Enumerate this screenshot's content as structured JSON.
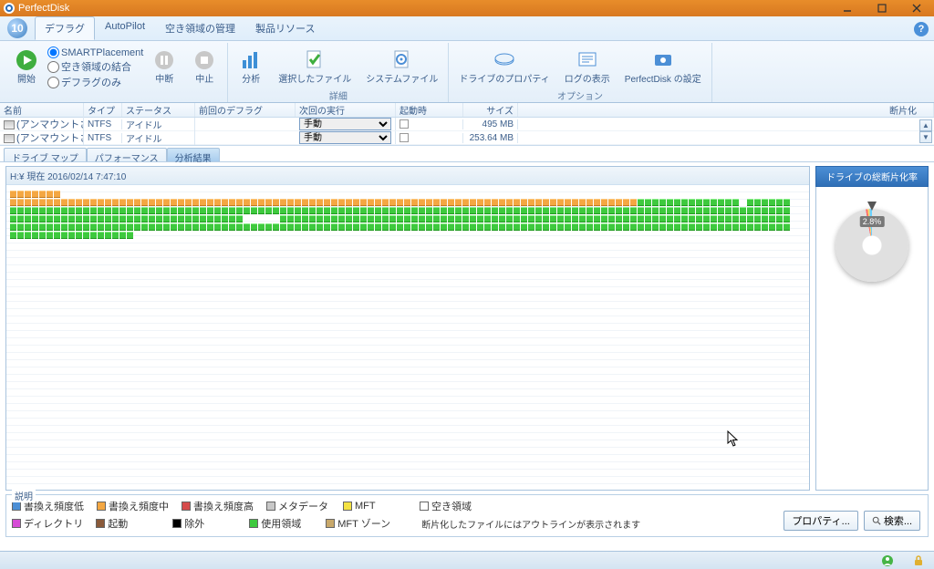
{
  "window": {
    "title": "PerfectDisk"
  },
  "ribbon_tabs": {
    "defrag": "デフラグ",
    "autopilot": "AutoPilot",
    "freespace": "空き領域の管理",
    "resources": "製品リソース"
  },
  "ribbon": {
    "start": "開始",
    "placement_opts": {
      "smart": "SMARTPlacement",
      "consolidate": "空き領域の結合",
      "defrag_only": "デフラグのみ"
    },
    "pause": "中断",
    "stop": "中止",
    "analyze": "分析",
    "selected_files": "選択したファイル",
    "system_files": "システムファイル",
    "drive_props": "ドライブのプロパティ",
    "log_view": "ログの表示",
    "pd_settings": "PerfectDisk の設定",
    "group_detail": "詳細",
    "group_options": "オプション"
  },
  "grid": {
    "cols": {
      "name": "名前",
      "type": "タイプ",
      "status": "ステータス",
      "last": "前回のデフラグ",
      "next": "次回の実行",
      "boot": "起動時",
      "size": "サイズ",
      "frag": "断片化"
    },
    "rows": [
      {
        "name": "(アンマウントされ..",
        "type": "NTFS",
        "status": "アイドル",
        "next": "手動",
        "size": "495 MB"
      },
      {
        "name": "(アンマウントされ..",
        "type": "NTFS",
        "status": "アイドル",
        "next": "手動",
        "size": "253.64 MB"
      }
    ]
  },
  "subtabs": {
    "map": "ドライブ マップ",
    "perf": "パフォーマンス",
    "analysis": "分析結果"
  },
  "map": {
    "title": "H:¥ 現在 2016/02/14 7:47:10"
  },
  "sidebar": {
    "title": "ドライブの総断片化率",
    "pct": "2.8%"
  },
  "legend": {
    "title": "説明",
    "items": {
      "low": "書換え頻度低",
      "mid": "書換え頻度中",
      "high": "書換え頻度高",
      "meta": "メタデータ",
      "mft": "MFT",
      "free": "空き領域",
      "dir": "ディレクトリ",
      "boot": "起動",
      "excl": "除外",
      "used": "使用領域",
      "mftzone": "MFT ゾーン"
    },
    "note": "断片化したファイルにはアウトラインが表示されます",
    "btn_props": "プロパティ...",
    "btn_search": "検索..."
  }
}
